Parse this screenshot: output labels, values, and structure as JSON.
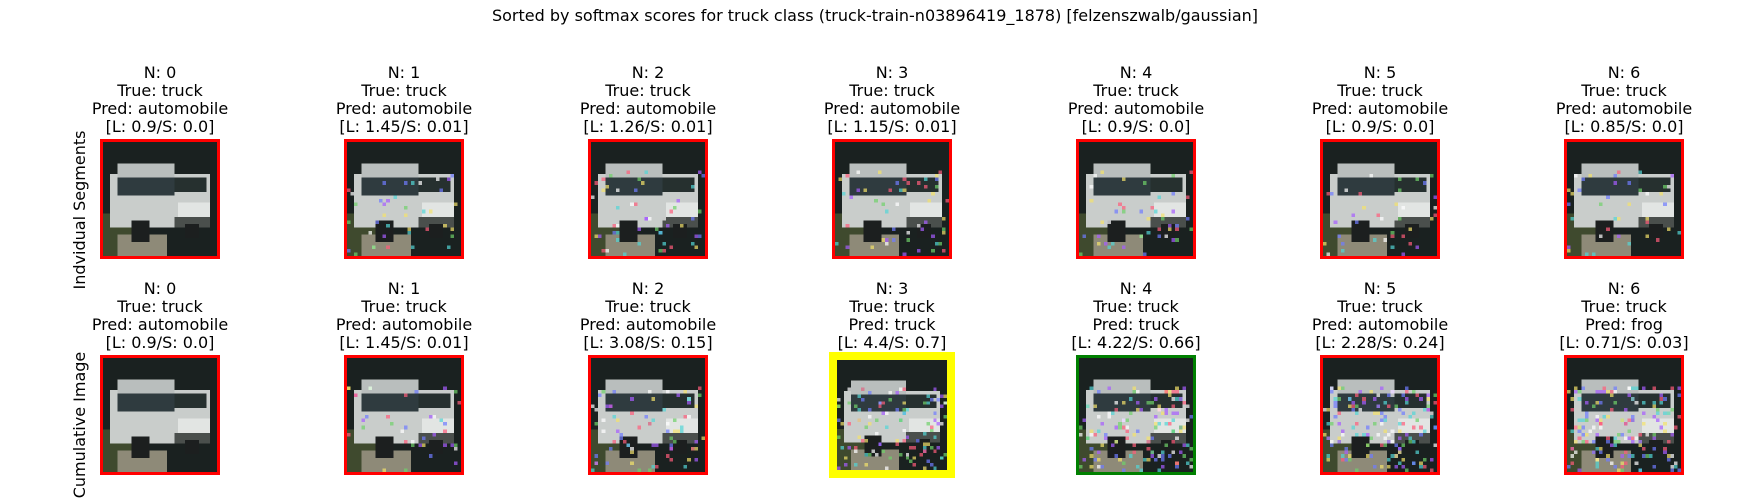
{
  "figure": {
    "suptitle": "Sorted by softmax scores for truck class (truck-train-n03896419_1878) [felzenszwalb/gaussian]"
  },
  "rows": [
    {
      "label": "Indvidual Segments",
      "cells": [
        {
          "n": "N: 0",
          "true": "True: truck",
          "pred": "Pred: automobile",
          "scores": "[L: 0.9/S: 0.0]",
          "frame_color": "#ff0000",
          "noise": 0.0
        },
        {
          "n": "N: 1",
          "true": "True: truck",
          "pred": "Pred: automobile",
          "scores": "[L: 1.45/S: 0.01]",
          "frame_color": "#ff0000",
          "noise": 0.15
        },
        {
          "n": "N: 2",
          "true": "True: truck",
          "pred": "Pred: automobile",
          "scores": "[L: 1.26/S: 0.01]",
          "frame_color": "#ff0000",
          "noise": 0.2
        },
        {
          "n": "N: 3",
          "true": "True: truck",
          "pred": "Pred: automobile",
          "scores": "[L: 1.15/S: 0.01]",
          "frame_color": "#ff0000",
          "noise": 0.2
        },
        {
          "n": "N: 4",
          "true": "True: truck",
          "pred": "Pred: automobile",
          "scores": "[L: 0.9/S: 0.0]",
          "frame_color": "#ff0000",
          "noise": 0.18
        },
        {
          "n": "N: 5",
          "true": "True: truck",
          "pred": "Pred: automobile",
          "scores": "[L: 0.9/S: 0.0]",
          "frame_color": "#ff0000",
          "noise": 0.15
        },
        {
          "n": "N: 6",
          "true": "True: truck",
          "pred": "Pred: automobile",
          "scores": "[L: 0.85/S: 0.0]",
          "frame_color": "#ff0000",
          "noise": 0.15
        }
      ]
    },
    {
      "label": "Cumulative Image",
      "cells": [
        {
          "n": "N: 0",
          "true": "True: truck",
          "pred": "Pred: automobile",
          "scores": "[L: 0.9/S: 0.0]",
          "frame_color": "#ff0000",
          "noise": 0.0
        },
        {
          "n": "N: 1",
          "true": "True: truck",
          "pred": "Pred: automobile",
          "scores": "[L: 1.45/S: 0.01]",
          "frame_color": "#ff0000",
          "noise": 0.15
        },
        {
          "n": "N: 2",
          "true": "True: truck",
          "pred": "Pred: automobile",
          "scores": "[L: 3.08/S: 0.15]",
          "frame_color": "#ff0000",
          "noise": 0.3
        },
        {
          "n": "N: 3",
          "true": "True: truck",
          "pred": "Pred: truck",
          "scores": "[L: 4.4/S: 0.7]",
          "frame_color": "#ffff00",
          "noise": 0.45
        },
        {
          "n": "N: 4",
          "true": "True: truck",
          "pred": "Pred: truck",
          "scores": "[L: 4.22/S: 0.66]",
          "frame_color": "#008000",
          "noise": 0.55
        },
        {
          "n": "N: 5",
          "true": "True: truck",
          "pred": "Pred: automobile",
          "scores": "[L: 2.28/S: 0.24]",
          "frame_color": "#ff0000",
          "noise": 0.6
        },
        {
          "n": "N: 6",
          "true": "True: truck",
          "pred": "Pred: frog",
          "scores": "[L: 0.71/S: 0.03]",
          "frame_color": "#ff0000",
          "noise": 0.65
        }
      ]
    }
  ]
}
